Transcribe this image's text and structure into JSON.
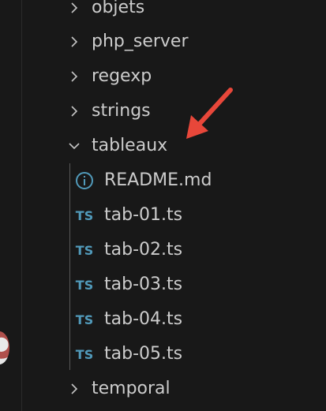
{
  "explorer": {
    "folders_above": [
      {
        "label": "objets"
      },
      {
        "label": "php_server"
      },
      {
        "label": "regexp"
      },
      {
        "label": "strings"
      }
    ],
    "open_folder": {
      "label": "tableaux",
      "files": [
        {
          "label": "README.md",
          "icon": "info-icon"
        },
        {
          "label": "tab-01.ts",
          "icon": "ts-icon",
          "icon_text": "TS"
        },
        {
          "label": "tab-02.ts",
          "icon": "ts-icon",
          "icon_text": "TS"
        },
        {
          "label": "tab-03.ts",
          "icon": "ts-icon",
          "icon_text": "TS"
        },
        {
          "label": "tab-04.ts",
          "icon": "ts-icon",
          "icon_text": "TS"
        },
        {
          "label": "tab-05.ts",
          "icon": "ts-icon",
          "icon_text": "TS"
        }
      ]
    },
    "folders_below": [
      {
        "label": "temporal"
      }
    ]
  },
  "colors": {
    "background": "#181818",
    "text": "#cccccc",
    "ts_icon": "#519aba",
    "info_icon": "#519aba",
    "annotation_arrow": "#e8473a"
  }
}
